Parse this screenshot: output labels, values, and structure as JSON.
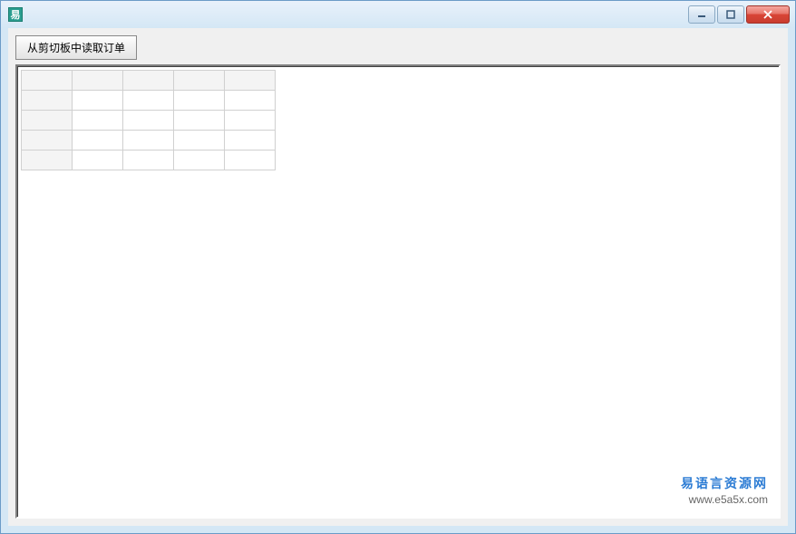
{
  "window": {
    "title": "",
    "icon_glyph": "易"
  },
  "toolbar": {
    "read_clipboard_button": "从剪切板中读取订单"
  },
  "grid": {
    "columns": [
      "",
      "",
      "",
      ""
    ],
    "rows": [
      [
        "",
        "",
        "",
        ""
      ],
      [
        "",
        "",
        "",
        ""
      ],
      [
        "",
        "",
        "",
        ""
      ],
      [
        "",
        "",
        "",
        ""
      ]
    ]
  },
  "watermark": {
    "title": "易语言资源网",
    "url": "www.e5a5x.com"
  }
}
